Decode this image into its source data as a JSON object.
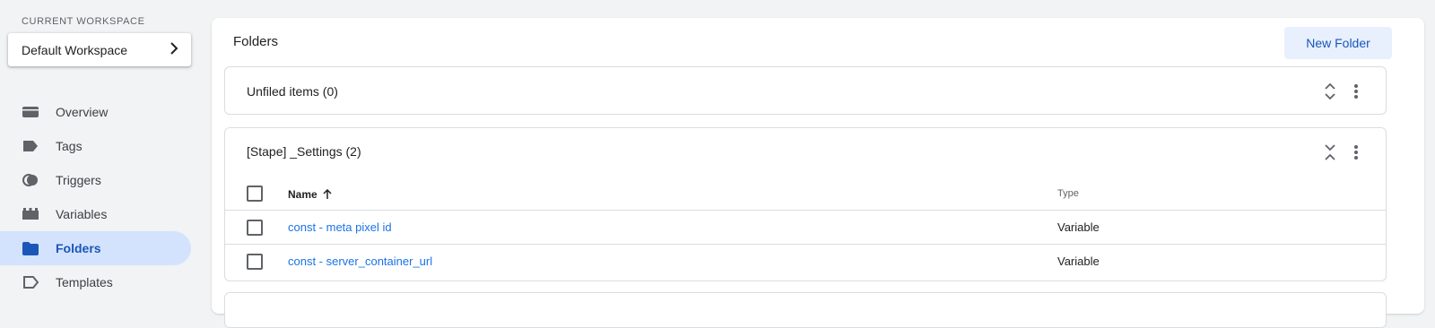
{
  "sidebar": {
    "workspace_label": "CURRENT WORKSPACE",
    "workspace_name": "Default Workspace",
    "items": [
      {
        "label": "Overview",
        "icon": "overview-icon"
      },
      {
        "label": "Tags",
        "icon": "tag-icon"
      },
      {
        "label": "Triggers",
        "icon": "trigger-icon"
      },
      {
        "label": "Variables",
        "icon": "variables-icon"
      },
      {
        "label": "Folders",
        "icon": "folder-icon",
        "active": true
      },
      {
        "label": "Templates",
        "icon": "template-icon"
      }
    ]
  },
  "main": {
    "title": "Folders",
    "new_folder_label": "New Folder",
    "folders": [
      {
        "title": "Unfiled items (0)"
      },
      {
        "title": "[Stape] _Settings (2)",
        "columns": {
          "name": "Name",
          "type": "Type"
        },
        "rows": [
          {
            "name": "const - meta pixel id",
            "type": "Variable"
          },
          {
            "name": "const - server_container_url",
            "type": "Variable"
          }
        ]
      }
    ]
  },
  "colors": {
    "accent": "#1a73e8",
    "active_bg": "#d3e3fd",
    "button_bg": "#e8f0fe"
  }
}
